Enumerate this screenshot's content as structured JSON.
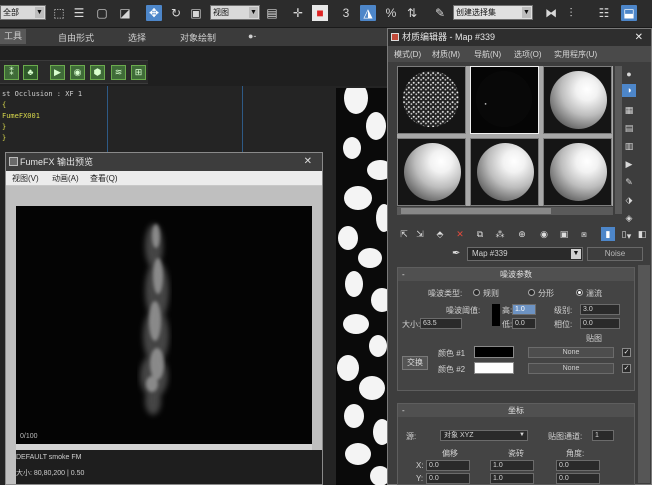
{
  "toolbar": {
    "selection_filter": "全部",
    "ref_coord": "视图",
    "named_selection": "创建选择集",
    "snap_angle_label": "3",
    "snap_percent_label": "%"
  },
  "menu": {
    "items": [
      "工具",
      "自由形式",
      "选择",
      "对象绘制",
      "●-"
    ]
  },
  "script": {
    "line1": "st Occlusion : XF 1",
    "line2": "{",
    "line3": "FumeFX001",
    "line4": "}",
    "line5": "}"
  },
  "fume": {
    "title": "FumeFX 输出预览",
    "menu": [
      "视图(V)",
      "动画(A)",
      "查看(Q)"
    ],
    "frame": "0/100",
    "status_line1": "DEFAULT smoke FM",
    "status_line2": "大小: 80,80,200 | 0.50"
  },
  "mat": {
    "title": "材质编辑器 - Map #339",
    "menu": [
      "模式(D)",
      "材质(M)",
      "导航(N)",
      "选项(O)",
      "实用程序(U)"
    ],
    "map_name": "Map #339",
    "map_type": "Noise",
    "noise_params": {
      "header": "噪波参数",
      "noise_type_label": "噪波类型:",
      "types": [
        "规则",
        "分形",
        "湍流"
      ],
      "threshold_label": "噪波阈值:",
      "high_label": "高:",
      "high_value": "1.0",
      "low_label": "低:",
      "low_value": "0.0",
      "levels_label": "级别:",
      "levels_value": "3.0",
      "phase_label": "相位:",
      "phase_value": "0.0",
      "size_label": "大小:",
      "size_value": "63.5",
      "maps_label": "贴图",
      "color1_label": "颜色 #1",
      "color2_label": "颜色 #2",
      "color1_map": "None",
      "color2_map": "None",
      "swap_label": "交换"
    },
    "coords": {
      "header": "坐标",
      "source_label": "源:",
      "source_value": "对象 XYZ",
      "map_channel_label": "贴图通道:",
      "map_channel_value": "1",
      "offset_label": "偏移",
      "tiling_label": "瓷砖",
      "angle_label": "角度:",
      "x_label": "X:",
      "y_label": "Y:",
      "offset_x": "0.0",
      "offset_y": "0.0",
      "tiling_x": "1.0",
      "tiling_y": "1.0",
      "angle_x": "0.0",
      "angle_y": "0.0"
    }
  },
  "colors": {
    "accent": "#4d86c9",
    "highlight_spinner": "#6d93c3",
    "delete_red": "#e34a3c"
  }
}
